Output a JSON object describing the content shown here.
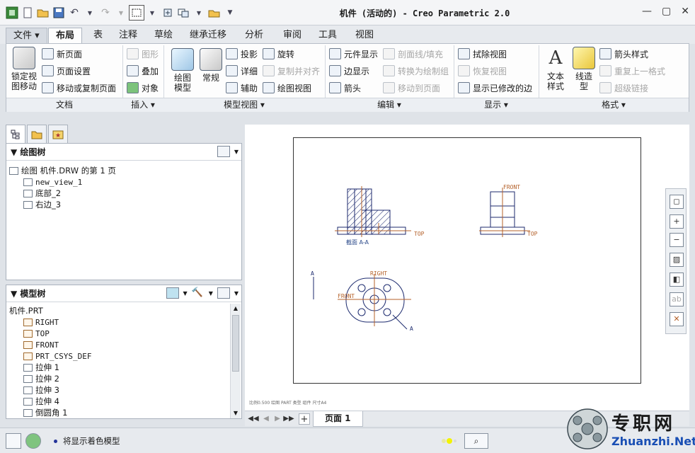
{
  "title": "机件 (活动的) - Creo Parametric 2.0",
  "tabs": [
    {
      "label": "文件"
    },
    {
      "label": "布局"
    },
    {
      "label": "表"
    },
    {
      "label": "注释"
    },
    {
      "label": "草绘"
    },
    {
      "label": "继承迁移"
    },
    {
      "label": "分析"
    },
    {
      "label": "审阅"
    },
    {
      "label": "工具"
    },
    {
      "label": "视图"
    }
  ],
  "ribbon": {
    "lock_view": "锁定视\n图移动",
    "new_page": "新页面",
    "page_setup": "页面设置",
    "move_copy_page": "移动或复制页面",
    "graphics": "图形",
    "overlay": "叠加",
    "object": "对象",
    "drawing_model": "绘图\n模型",
    "general": "常规",
    "projection": "投影",
    "detail": "详细",
    "auxiliary": "辅助",
    "revolve": "旋转",
    "copy_align": "复制并对齐",
    "drawing_view": "绘图视图",
    "component_display": "元件显示",
    "edge_display": "边显示",
    "arrow": "箭头",
    "section_hatch": "剖面线/填充",
    "convert_group": "转换为绘制组",
    "move_to_page": "移动到页面",
    "erase_view": "拭除视图",
    "resume_view": "恢复视图",
    "show_modified_edges": "显示已修改的边",
    "text_style": "文本\n样式",
    "line_style": "线造\n型",
    "arrow_style": "箭头样式",
    "repeat_format": "重复上一格式",
    "hyperlink": "超级链接",
    "groups": {
      "document": "文档",
      "insert": "插入",
      "model_views": "模型视图",
      "edit": "编辑",
      "display": "显示",
      "format": "格式"
    }
  },
  "drawing_tree": {
    "title": "绘图树",
    "root": "绘图 机件.DRW 的第 1 页",
    "items": [
      "new_view_1",
      "底部_2",
      "右边_3"
    ]
  },
  "model_tree": {
    "title": "模型树",
    "root": "机件.PRT",
    "items": [
      "RIGHT",
      "TOP",
      "FRONT",
      "PRT_CSYS_DEF",
      "拉伸 1",
      "拉伸 2",
      "拉伸 3",
      "拉伸 4",
      "倒圆角 1"
    ]
  },
  "drawing": {
    "label_front": "FRONT",
    "label_top": "TOP",
    "label_top2": "TOP",
    "label_right": "RIGHT",
    "label_front2": "FRONT",
    "section_label": "截面 A-A",
    "label_a": "A",
    "label_a2": "A",
    "bottom_strip": "比例0.500   绘图 PART   类型 组件   尺寸A4"
  },
  "page_tab": "页面 1",
  "status": {
    "message": "将显示着色模型"
  },
  "watermark": {
    "text": "专职网",
    "url": "Zhuanzhi.Net"
  },
  "colors": {
    "accent": "#2b4a8a",
    "drawing_line": "#1c2a6e",
    "datum": "#b4612a"
  }
}
